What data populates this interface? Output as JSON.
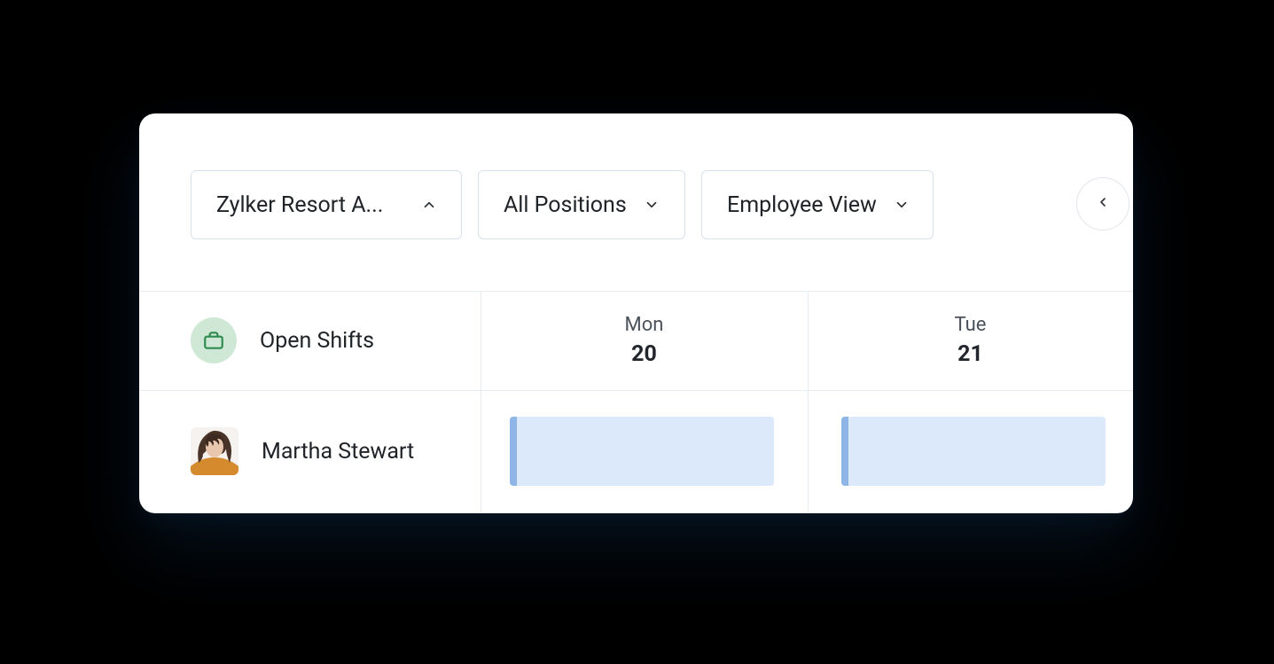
{
  "filters": {
    "location_label": "Zylker Resort A...",
    "positions_label": "All Positions",
    "view_label": "Employee View"
  },
  "header": {
    "open_shifts_label": "Open Shifts",
    "days": [
      {
        "name": "Mon",
        "num": "20"
      },
      {
        "name": "Tue",
        "num": "21"
      }
    ]
  },
  "employee": {
    "name": "Martha Stewart"
  }
}
